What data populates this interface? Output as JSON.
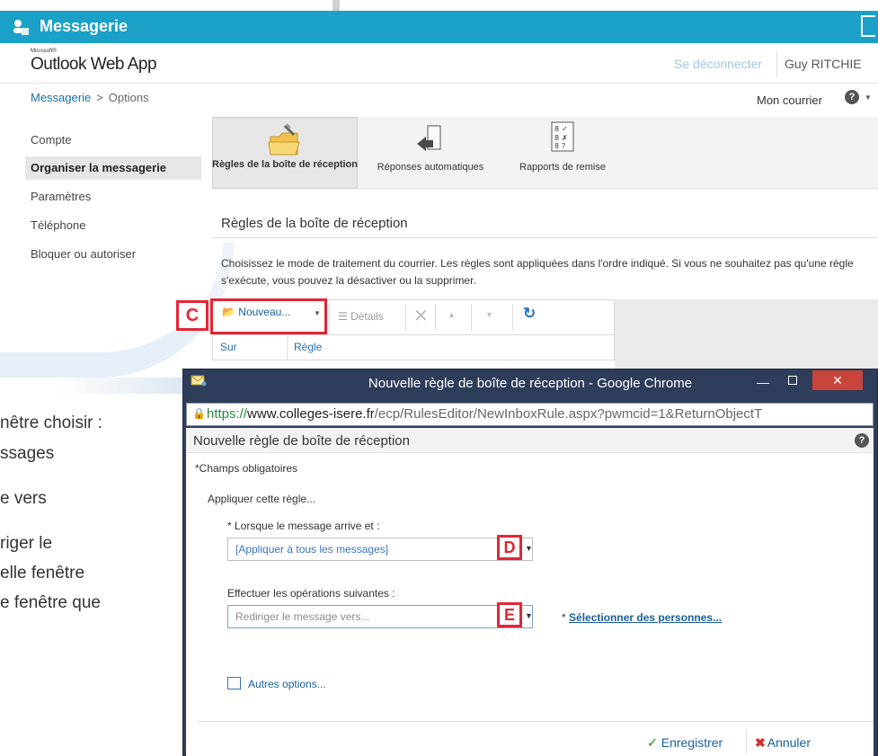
{
  "app": {
    "title": "Messagerie",
    "logo_small": "Microsoft®",
    "logo": "Outlook Web App",
    "signout": "Se déconnecter",
    "username": "Guy RITCHIE"
  },
  "breadcrumb": {
    "root": "Messagerie",
    "separator": ">",
    "current": "Options"
  },
  "header_right": {
    "mon_courrier": "Mon courrier",
    "help": "?"
  },
  "nav": {
    "items": [
      {
        "label": "Compte",
        "selected": false
      },
      {
        "label": "Organiser la messagerie",
        "selected": true
      },
      {
        "label": "Paramètres",
        "selected": false
      },
      {
        "label": "Téléphone",
        "selected": false
      },
      {
        "label": "Bloquer ou autoriser",
        "selected": false
      }
    ]
  },
  "ribbon": {
    "tabs": [
      {
        "label": "Règles de la boîte de réception",
        "icon": "inbox-rules-icon"
      },
      {
        "label": "Réponses automatiques",
        "icon": "auto-reply-icon"
      },
      {
        "label": "Rapports de remise",
        "icon": "delivery-report-icon"
      }
    ]
  },
  "section": {
    "title": "Règles de la boîte de réception",
    "description": "Choisissez le mode de traitement du courrier. Les règles sont appliquées dans l'ordre indiqué. Si vous ne souhaitez pas qu'une règle s'exécute, vous pouvez la désactiver ou la supprimer."
  },
  "toolbar": {
    "new_label": "Nouveau...",
    "details_label": "Détails"
  },
  "rules_table": {
    "columns": [
      "Sur",
      "Règle"
    ]
  },
  "callouts": {
    "c": "C",
    "d": "D",
    "e": "E"
  },
  "left_partial_text": [
    "nêtre choisir :",
    "ssages",
    "e vers",
    "riger le",
    "elle fenêtre",
    "e fenêtre que"
  ],
  "popup": {
    "window_title": "Nouvelle règle de boîte de réception - Google Chrome",
    "url_https": "https://",
    "url_host": "www.colleges-isere.fr",
    "url_rest": "/ecp/RulesEditor/NewInboxRule.aspx?pwmcid=1&ReturnObjectT",
    "heading": "Nouvelle règle de boîte de réception",
    "help": "?",
    "required_note": "*Champs obligatoires",
    "apply_rule": "Appliquer cette règle...",
    "when_label": "* Lorsque le message arrive et :",
    "when_value": "[Appliquer à tous les messages]",
    "do_label": "Effectuer les opérations suivantes :",
    "do_value": "Rediriger le message vers...",
    "select_people_prefix": "* ",
    "select_people_link": "Sélectionner des personnes...",
    "more_options": "Autres options...",
    "save": "Enregistrer",
    "cancel": "Annuler"
  }
}
